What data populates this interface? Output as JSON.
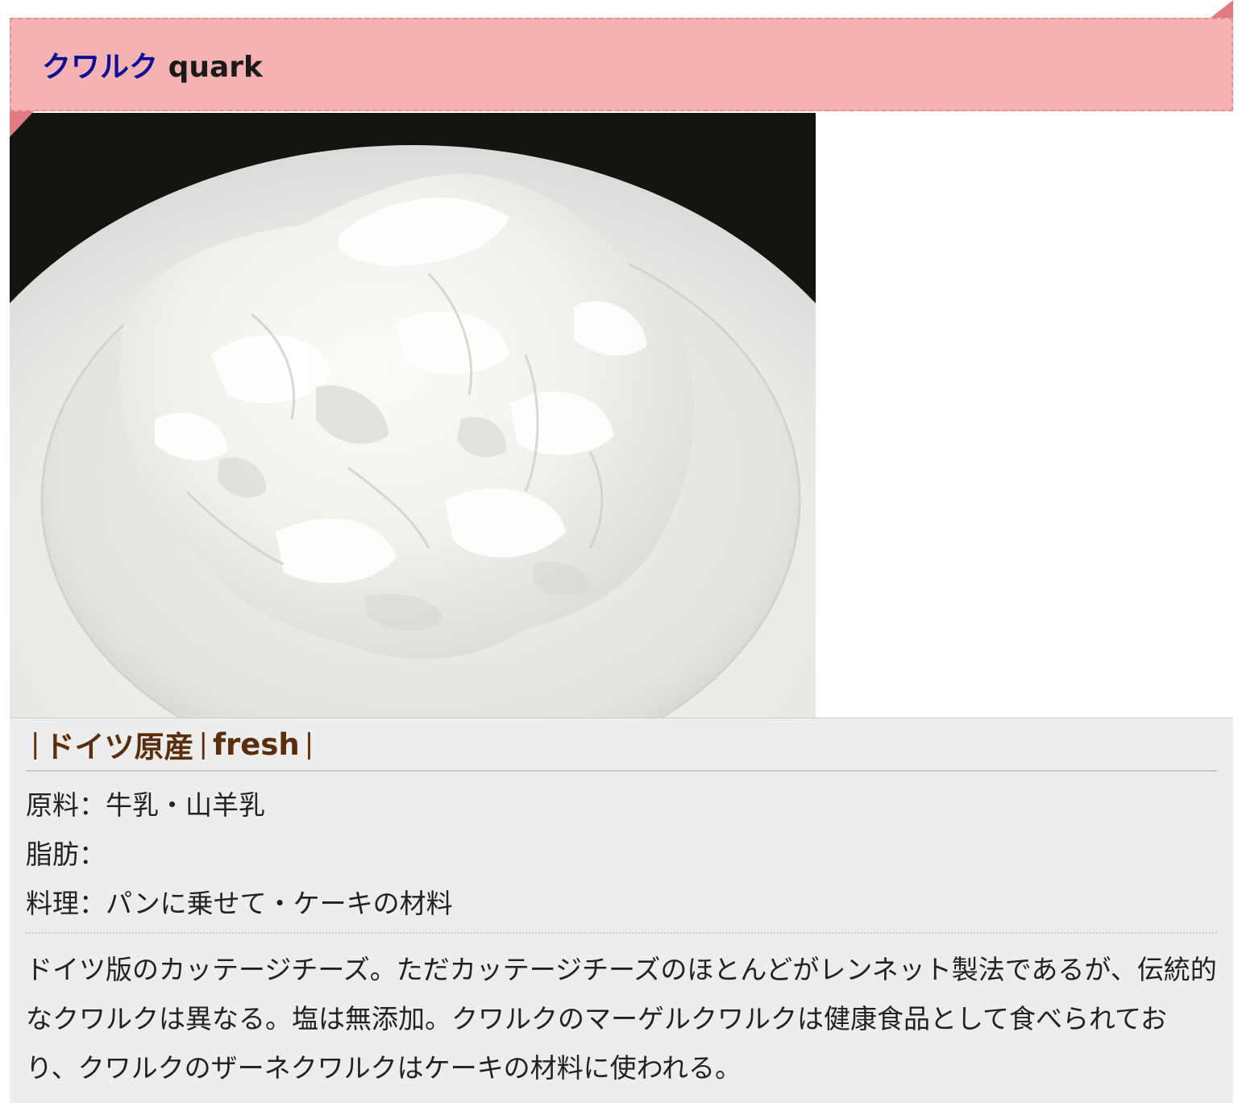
{
  "heading": {
    "name_jp": "クワルク",
    "name_en": "quark"
  },
  "photo": {
    "subject": "quark cheese in a white bowl"
  },
  "tags": {
    "bar_left": "|",
    "origin": "ドイツ原産",
    "bar_mid": "|",
    "type": "fresh",
    "bar_right": "|"
  },
  "specs": {
    "ingredients": "原料：牛乳・山羊乳",
    "fat": "脂肪：",
    "cuisine": "料理：パンに乗せて・ケーキの材料"
  },
  "description": "ドイツ版のカッテージチーズ。ただカッテージチーズのほとんどがレンネット製法であるが、伝統的なクワルクは異なる。塩は無添加。クワルクのマーゲルクワルクは健康食品として食べられており、クワルクのザーネクワルクはケーキの材料に使われる。",
  "colors": {
    "ribbon": "#f4b2b2",
    "ribbon_border": "#ea8f8f",
    "ribbon_fold": "#e27a82",
    "heading_jp": "#0c0c95",
    "tag_text": "#5a2e0c",
    "info_bg": "#ededed"
  }
}
